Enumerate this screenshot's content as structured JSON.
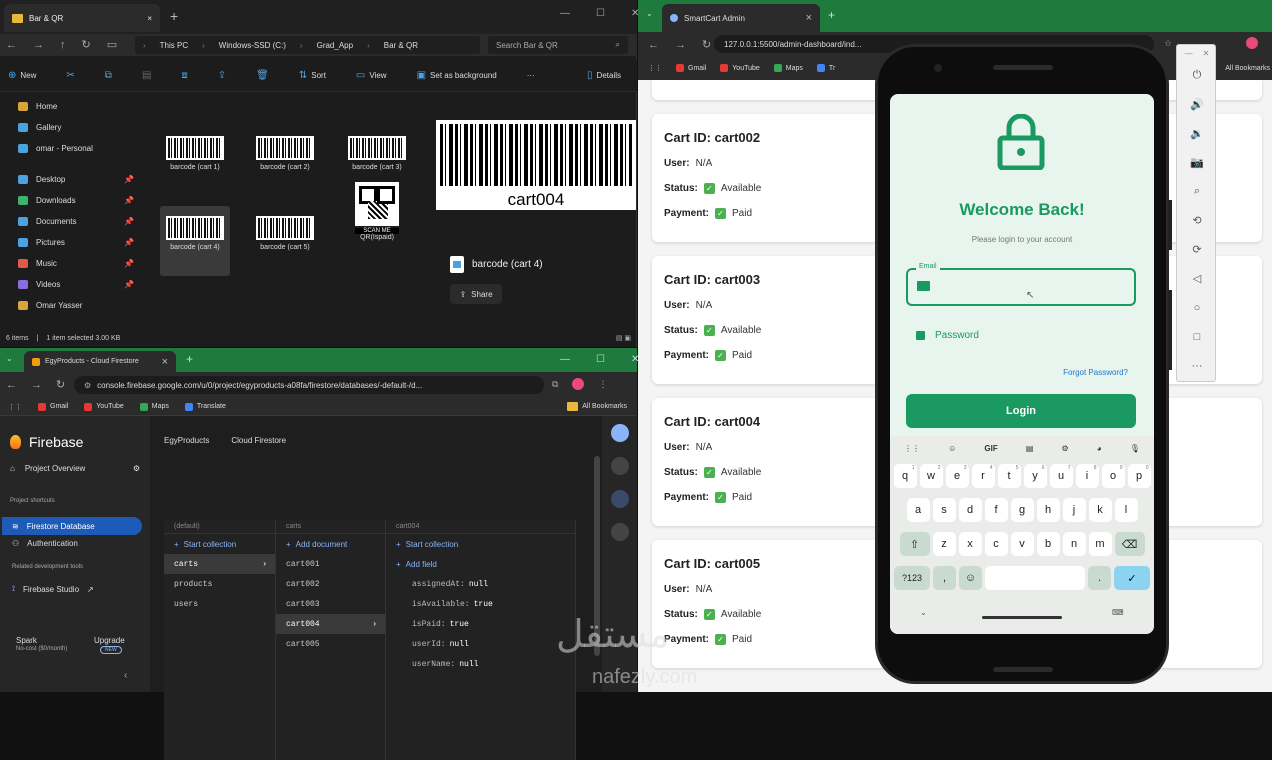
{
  "explorer": {
    "tab_title": "Bar & QR",
    "path": [
      "This PC",
      "Windows-SSD (C:)",
      "Grad_App",
      "Bar & QR"
    ],
    "search_placeholder": "Search Bar & QR",
    "commands": {
      "new": "New",
      "sort": "Sort",
      "view": "View",
      "set_bg": "Set as background",
      "details": "Details"
    },
    "sidebar": [
      {
        "label": "Home",
        "icon": "home-icon",
        "pinned": false
      },
      {
        "label": "Gallery",
        "icon": "gallery-icon",
        "pinned": false
      },
      {
        "label": "omar - Personal",
        "icon": "cloud-icon",
        "pinned": false
      },
      {
        "label": "Desktop",
        "icon": "desktop-icon",
        "pinned": true
      },
      {
        "label": "Downloads",
        "icon": "downloads-icon",
        "pinned": true
      },
      {
        "label": "Documents",
        "icon": "documents-icon",
        "pinned": true
      },
      {
        "label": "Pictures",
        "icon": "pictures-icon",
        "pinned": true
      },
      {
        "label": "Music",
        "icon": "music-icon",
        "pinned": true
      },
      {
        "label": "Videos",
        "icon": "videos-icon",
        "pinned": true
      },
      {
        "label": "Omar Yasser",
        "icon": "folder-icon",
        "pinned": false
      }
    ],
    "files": [
      {
        "name": "barcode (cart 1)",
        "kind": "barcode"
      },
      {
        "name": "barcode (cart 2)",
        "kind": "barcode"
      },
      {
        "name": "barcode (cart 3)",
        "kind": "barcode"
      },
      {
        "name": "barcode (cart 4)",
        "kind": "barcode",
        "selected": true
      },
      {
        "name": "barcode (cart 5)",
        "kind": "barcode"
      },
      {
        "name": "QR(Ispaid)",
        "kind": "qr",
        "caption": "SCAN ME"
      }
    ],
    "preview": {
      "barcode_text": "cart004",
      "file_name": "barcode (cart 4)",
      "share": "Share"
    },
    "status": {
      "items": "6 items",
      "selection": "1 item selected  3.00 KB"
    }
  },
  "firebase_browser": {
    "tab_title": "EgyProducts - Cloud Firestore",
    "url": "console.firebase.google.com/u/0/project/egyproducts-a08fa/firestore/databases/-default-/d...",
    "bookmarks": [
      "Gmail",
      "YouTube",
      "Maps",
      "Translate"
    ],
    "all_bookmarks": "All Bookmarks",
    "brand": "Firebase",
    "project": "EgyProducts",
    "product": "Cloud Firestore",
    "nav": {
      "overview": "Project Overview",
      "shortcuts": "Project shortcuts",
      "firestore": "Firestore Database",
      "auth": "Authentication",
      "related": "Related development tools",
      "studio": "Firebase Studio",
      "plan": "Spark",
      "plan_sub": "No-cost ($0/month)",
      "upgrade": "Upgrade",
      "new_badge": "NEW"
    },
    "col1": {
      "head": "(default)",
      "add": "Start collection",
      "items": [
        "carts",
        "products",
        "users"
      ]
    },
    "col2": {
      "head": "carts",
      "add": "Add document",
      "items": [
        "cart001",
        "cart002",
        "cart003",
        "cart004",
        "cart005"
      ]
    },
    "col3": {
      "head": "cart004",
      "add": "Start collection",
      "add2": "Add field",
      "fields": [
        {
          "k": "assignedAt:",
          "v": "null"
        },
        {
          "k": "isAvailable:",
          "v": "true"
        },
        {
          "k": "isPaid:",
          "v": "true"
        },
        {
          "k": "userId:",
          "v": "null"
        },
        {
          "k": "userName:",
          "v": "null"
        }
      ]
    }
  },
  "admin_browser": {
    "tab_title": "SmartCart Admin",
    "url": "127.0.0.1:5500/admin-dashboard/ind...",
    "bookmarks": [
      "Gmail",
      "YouTube",
      "Maps",
      "Tr"
    ],
    "all_bookmarks": "All Bookmarks",
    "cards": [
      {
        "id": "Cart ID: cart002",
        "user": "N/A",
        "status": "Available",
        "payment": "Paid"
      },
      {
        "id": "Cart ID: cart003",
        "user": "N/A",
        "status": "Available",
        "payment": "Paid"
      },
      {
        "id": "Cart ID: cart004",
        "user": "N/A",
        "status": "Available",
        "payment": "Paid"
      },
      {
        "id": "Cart ID: cart005",
        "user": "N/A",
        "status": "Available",
        "payment": "Paid"
      }
    ],
    "labels": {
      "user": "User:",
      "status": "Status:",
      "payment": "Payment:"
    }
  },
  "phone": {
    "welcome": "Welcome Back!",
    "subtitle": "Please login to your account",
    "email_label": "Email",
    "password_placeholder": "Password",
    "forgot": "Forgot Password?",
    "login": "Login",
    "kbd_tools": [
      "GIF"
    ],
    "rows": [
      [
        "q",
        "w",
        "e",
        "r",
        "t",
        "y",
        "u",
        "i",
        "o",
        "p"
      ],
      [
        "a",
        "s",
        "d",
        "f",
        "g",
        "h",
        "j",
        "k",
        "l"
      ],
      [
        "z",
        "x",
        "c",
        "v",
        "b",
        "n",
        "m"
      ]
    ],
    "row1_hints": [
      "1",
      "2",
      "3",
      "4",
      "5",
      "6",
      "7",
      "8",
      "9",
      "0"
    ],
    "symbols": "?123",
    "comma": ",",
    "period": "."
  },
  "watermark": {
    "arabic": "مستقل",
    "latin": "nafezly.com"
  },
  "colors": {
    "accent": "#1a9960",
    "chrome_green": "#1f7a3e"
  }
}
